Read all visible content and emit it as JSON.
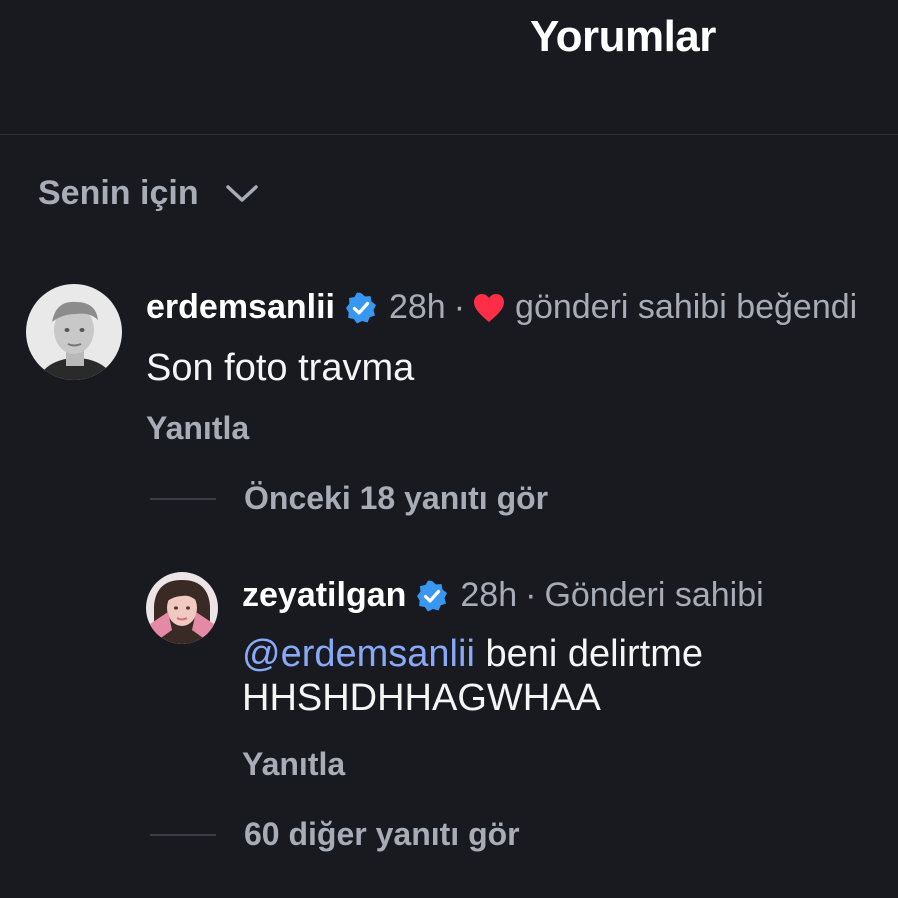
{
  "header": {
    "title": "Yorumlar"
  },
  "sort": {
    "label": "Senin için",
    "chevron_icon": "chevron-down-icon"
  },
  "comments": [
    {
      "username": "erdemsanlii",
      "verified": true,
      "time": "28h",
      "separator": "·",
      "liked_by_author_icon": "heart-icon",
      "liked_by_author_text": "gönderi sahibi beğendi",
      "text": "Son foto travma",
      "reply_label": "Yanıtla",
      "toggle_label": "Önceki 18 yanıtı gör"
    },
    {
      "username": "zeyatilgan",
      "verified": true,
      "time": "28h",
      "separator": "·",
      "author_badge": "Gönderi sahibi",
      "mention": "@erdemsanlii",
      "text_line1_rest": " beni delirtme",
      "text_line2": "HHSHDHHAGWHAA",
      "reply_label": "Yanıtla",
      "toggle_label": "60 diğer yanıtı gör"
    }
  ],
  "colors": {
    "background": "#181a1f",
    "muted_text": "#a8acb6",
    "mention": "#8aa8f8",
    "verified_badge": "#3897f0",
    "heart": "#ff2e47"
  }
}
